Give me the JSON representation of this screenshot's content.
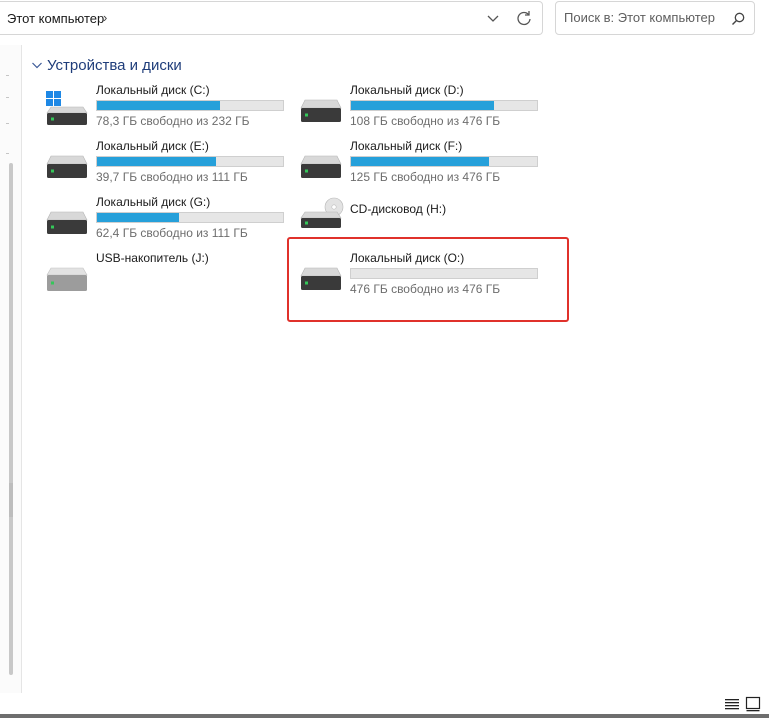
{
  "address_bar": {
    "breadcrumb": "Этот компьютер",
    "separator": "›"
  },
  "search": {
    "placeholder": "Поиск в: Этот компьютер"
  },
  "section": {
    "title": "Устройства и диски"
  },
  "drives": [
    {
      "name": "Локальный диск (C:)",
      "free_text": "78,3 ГБ свободно из 232 ГБ",
      "used_fraction": 0.66,
      "icon": "windows-drive-icon"
    },
    {
      "name": "Локальный диск (D:)",
      "free_text": "108 ГБ свободно из 476 ГБ",
      "used_fraction": 0.77,
      "icon": "hard-drive-icon"
    },
    {
      "name": "Локальный диск (E:)",
      "free_text": "39,7 ГБ свободно из 111 ГБ",
      "used_fraction": 0.64,
      "icon": "hard-drive-icon"
    },
    {
      "name": "Локальный диск (F:)",
      "free_text": "125 ГБ свободно из 476 ГБ",
      "used_fraction": 0.74,
      "icon": "hard-drive-icon"
    },
    {
      "name": "Локальный диск (G:)",
      "free_text": "62,4 ГБ свободно из 111 ГБ",
      "used_fraction": 0.44,
      "icon": "hard-drive-icon"
    },
    {
      "name": "CD-дисковод (H:)",
      "icon": "cd-drive-icon"
    },
    {
      "name": "USB-накопитель (J:)",
      "icon": "usb-drive-icon"
    },
    {
      "name": "Локальный диск (O:)",
      "free_text": "476 ГБ свободно из 476 ГБ",
      "used_fraction": 0.0,
      "icon": "hard-drive-icon"
    }
  ],
  "colors": {
    "bar_fill": "#26a0da",
    "section_title": "#1f3d7a",
    "highlight": "#e0312b"
  },
  "icons": {
    "address_dropdown": "chevron-down-icon",
    "refresh": "refresh-icon",
    "search": "search-icon",
    "view_details": "details-view-icon",
    "view_tiles": "tiles-view-icon"
  }
}
